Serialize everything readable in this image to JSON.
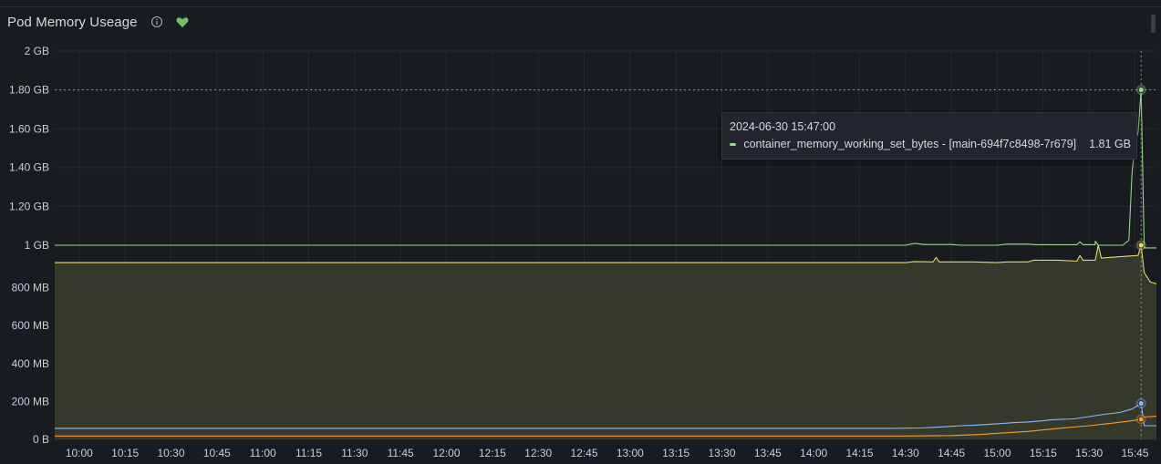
{
  "panel": {
    "title": "Pod Memory Useage",
    "info_icon": "info-circle-icon",
    "health_icon": "heart-icon",
    "health_color": "#73bf69"
  },
  "colors": {
    "background": "#181b1f",
    "grid": "#26292f",
    "text": "#ccccdc",
    "fill": "#3b3e2e"
  },
  "tooltip": {
    "time": "2024-06-30 15:47:00",
    "series": "container_memory_working_set_bytes - [main-694f7c8498-7r679]",
    "value": "1.81 GB",
    "color": "#96d98d"
  },
  "chart_data": {
    "type": "line",
    "title": "Pod Memory Useage",
    "x_unit": "time (2024-06-30)",
    "y_unit": "bytes",
    "xlim": [
      "09:52",
      "15:52"
    ],
    "ylim": [
      0,
      2048
    ],
    "y_ticks": [
      {
        "label": "2 GB",
        "value": 2048
      },
      {
        "label": "1.80 GB",
        "value": 1843
      },
      {
        "label": "1.60 GB",
        "value": 1638
      },
      {
        "label": "1.40 GB",
        "value": 1434
      },
      {
        "label": "1.20 GB",
        "value": 1229
      },
      {
        "label": "1 GB",
        "value": 1024
      },
      {
        "label": "800 MB",
        "value": 800
      },
      {
        "label": "600 MB",
        "value": 600
      },
      {
        "label": "400 MB",
        "value": 400
      },
      {
        "label": "200 MB",
        "value": 200
      },
      {
        "label": "0 B",
        "value": 0
      }
    ],
    "x_ticks": [
      "10:00",
      "10:15",
      "10:30",
      "10:45",
      "11:00",
      "11:15",
      "11:30",
      "11:45",
      "12:00",
      "12:15",
      "12:30",
      "12:45",
      "13:00",
      "13:15",
      "13:30",
      "13:45",
      "14:00",
      "14:15",
      "14:30",
      "14:45",
      "15:00",
      "15:15",
      "15:30",
      "15:45"
    ],
    "grid": true,
    "legend": "none",
    "crosshair": {
      "x": "15:47",
      "y": 1843
    },
    "series": [
      {
        "color": "#96d98d",
        "fill": false,
        "points": [
          [
            "09:52",
            1024
          ],
          [
            "14:30",
            1024
          ],
          [
            "14:33",
            1034
          ],
          [
            "14:36",
            1028
          ],
          [
            "14:45",
            1028
          ],
          [
            "14:48",
            1024
          ],
          [
            "15:00",
            1024
          ],
          [
            "15:03",
            1030
          ],
          [
            "15:10",
            1030
          ],
          [
            "15:13",
            1027
          ],
          [
            "15:26",
            1027
          ],
          [
            "15:27",
            1042
          ],
          [
            "15:28",
            1027
          ],
          [
            "15:32",
            1027
          ],
          [
            "15:32",
            1045
          ],
          [
            "15:33",
            1024
          ],
          [
            "15:41",
            1024
          ],
          [
            "15:43",
            1050
          ],
          [
            "15:44",
            1400
          ],
          [
            "15:45",
            1560
          ],
          [
            "15:46",
            1620
          ],
          [
            "15:47",
            1843
          ],
          [
            "15:48",
            1010
          ],
          [
            "15:52",
            1010
          ]
        ]
      },
      {
        "color": "#e6d96b",
        "fill": true,
        "points": [
          [
            "09:52",
            932
          ],
          [
            "14:30",
            932
          ],
          [
            "14:33",
            938
          ],
          [
            "14:39",
            936
          ],
          [
            "14:40",
            960
          ],
          [
            "14:41",
            936
          ],
          [
            "14:52",
            936
          ],
          [
            "15:00",
            932
          ],
          [
            "15:03",
            936
          ],
          [
            "15:10",
            936
          ],
          [
            "15:12",
            945
          ],
          [
            "15:20",
            945
          ],
          [
            "15:26",
            940
          ],
          [
            "15:27",
            970
          ],
          [
            "15:28",
            945
          ],
          [
            "15:32",
            945
          ],
          [
            "15:33",
            1024
          ],
          [
            "15:34",
            956
          ],
          [
            "15:46",
            970
          ],
          [
            "15:47",
            1024
          ],
          [
            "15:48",
            880
          ],
          [
            "15:50",
            830
          ],
          [
            "15:52",
            820
          ]
        ]
      },
      {
        "color": "#8ab8ff",
        "fill": false,
        "points": [
          [
            "09:52",
            58
          ],
          [
            "14:25",
            58
          ],
          [
            "14:35",
            60
          ],
          [
            "14:42",
            66
          ],
          [
            "14:48",
            72
          ],
          [
            "14:52",
            74
          ],
          [
            "15:00",
            82
          ],
          [
            "15:05",
            88
          ],
          [
            "15:10",
            92
          ],
          [
            "15:15",
            98
          ],
          [
            "15:18",
            104
          ],
          [
            "15:25",
            108
          ],
          [
            "15:30",
            120
          ],
          [
            "15:35",
            132
          ],
          [
            "15:40",
            142
          ],
          [
            "15:44",
            160
          ],
          [
            "15:47",
            190
          ],
          [
            "15:48",
            72
          ],
          [
            "15:52",
            72
          ]
        ]
      },
      {
        "color": "#ff9830",
        "fill": false,
        "points": [
          [
            "09:52",
            18
          ],
          [
            "14:30",
            18
          ],
          [
            "14:45",
            20
          ],
          [
            "14:55",
            26
          ],
          [
            "15:00",
            32
          ],
          [
            "15:10",
            42
          ],
          [
            "15:20",
            58
          ],
          [
            "15:30",
            72
          ],
          [
            "15:38",
            86
          ],
          [
            "15:44",
            98
          ],
          [
            "15:47",
            106
          ],
          [
            "15:48",
            118
          ],
          [
            "15:52",
            122
          ]
        ]
      }
    ]
  }
}
